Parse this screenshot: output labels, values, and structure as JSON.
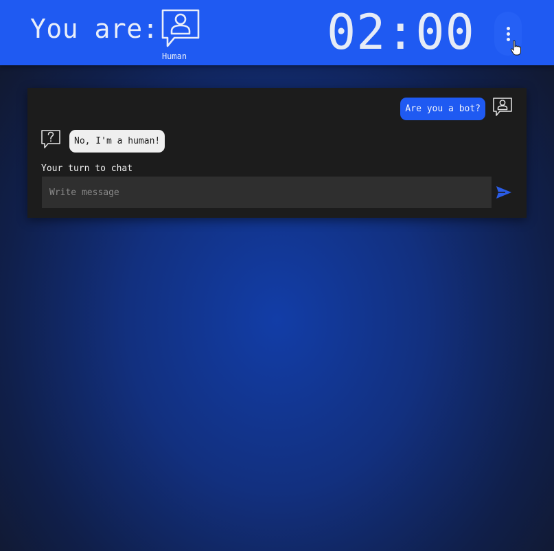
{
  "header": {
    "you_are_label": "You are:",
    "role_icon": "human-chat-icon",
    "role_label": "Human",
    "timer": "02:00",
    "menu_icon": "kebab-menu-icon",
    "background_color": "#1f5af2"
  },
  "chat": {
    "messages": [
      {
        "sender": "self",
        "avatar_icon": "human-chat-icon",
        "text": "Are you a bot?"
      },
      {
        "sender": "other",
        "avatar_icon": "unknown-question-chat-icon",
        "text": "No, I'm a human!"
      }
    ],
    "turn_label": "Your turn to chat",
    "input": {
      "placeholder": "Write message",
      "value": ""
    },
    "send_icon": "send-arrow-icon"
  },
  "colors": {
    "accent": "#1f5af2",
    "panel": "#1c1c1c",
    "input": "#2f2f2f",
    "received_bubble": "#efefef"
  }
}
